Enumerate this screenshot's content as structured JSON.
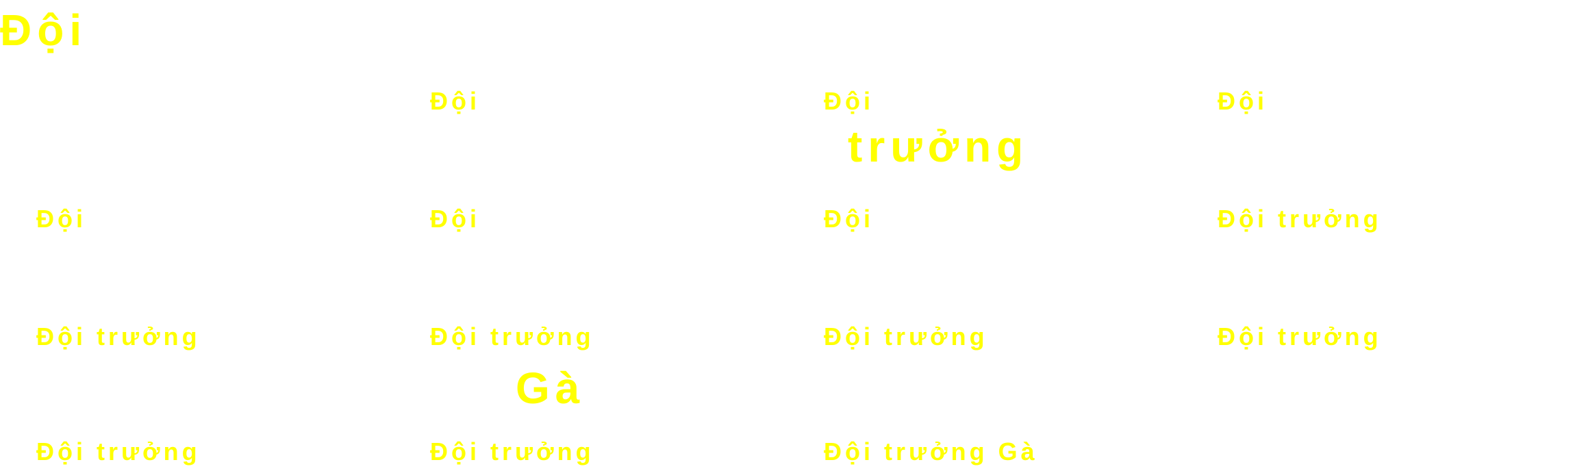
{
  "colors": {
    "text": "#ffff00",
    "background": "#ffffff"
  },
  "title": "Đội",
  "row1": {
    "c1": "Đội",
    "c2": "Đội",
    "c2_big": "trưởng",
    "c3": "Đội"
  },
  "row2": {
    "c0": "Đội",
    "c1": "Đội",
    "c2": "Đội",
    "c3": "Đội trưởng"
  },
  "row3": {
    "c0": "Đội trưởng",
    "c1": "Đội trưởng",
    "c1_big": "Gà",
    "c2": "Đội trưởng",
    "c3": "Đội trưởng"
  },
  "row4": {
    "c0": "Đội trưởng",
    "c1": "Đội trưởng",
    "c2": "Đội trưởng Gà"
  }
}
